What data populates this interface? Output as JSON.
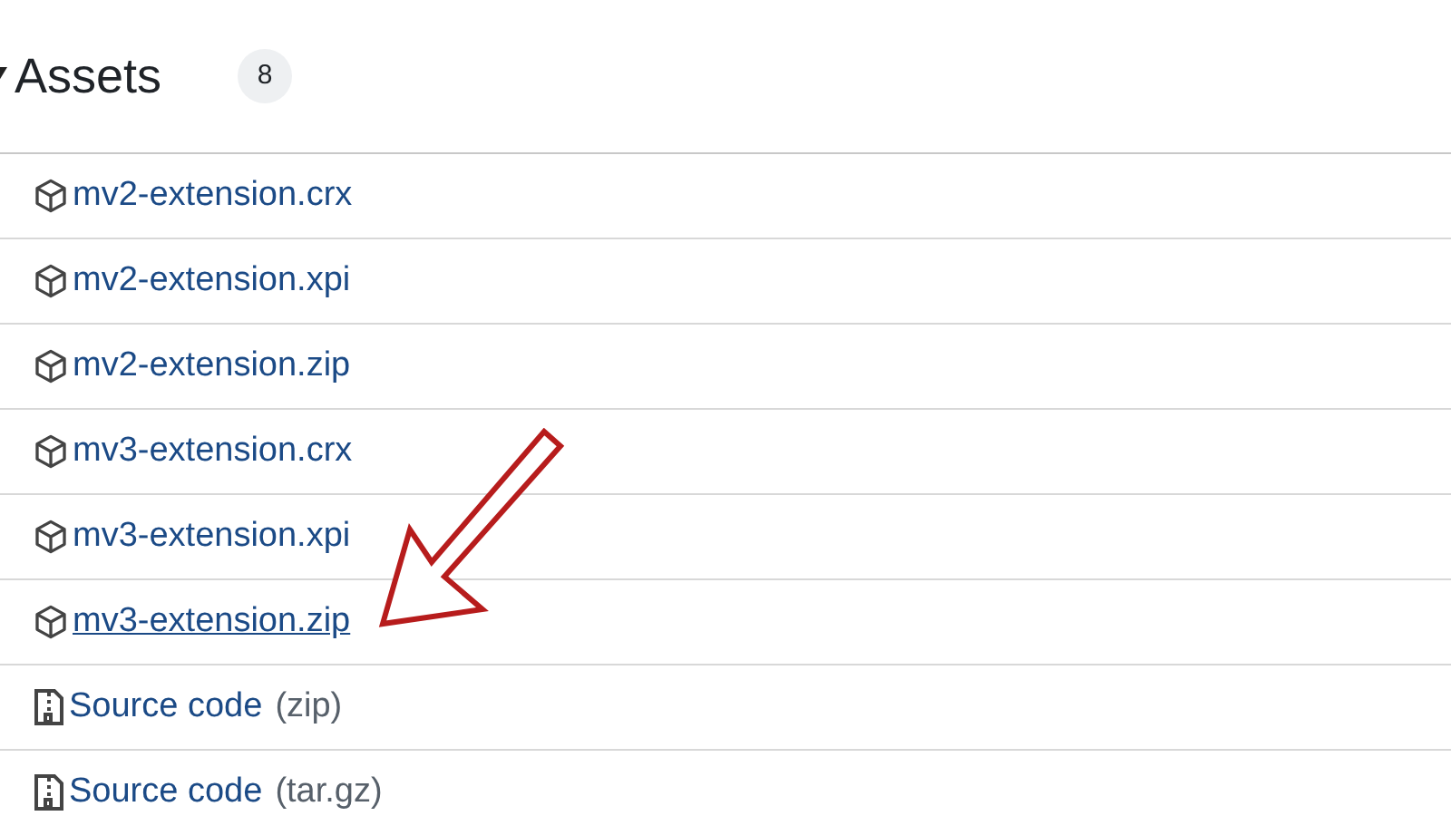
{
  "heading": {
    "title": "Assets",
    "count": "8",
    "expanded": true
  },
  "assets": [
    {
      "kind": "package",
      "name": "mv2-extension.crx",
      "hovered": false
    },
    {
      "kind": "package",
      "name": "mv2-extension.xpi",
      "hovered": false
    },
    {
      "kind": "package",
      "name": "mv2-extension.zip",
      "hovered": false
    },
    {
      "kind": "package",
      "name": "mv3-extension.crx",
      "hovered": false
    },
    {
      "kind": "package",
      "name": "mv3-extension.xpi",
      "hovered": false
    },
    {
      "kind": "package",
      "name": "mv3-extension.zip",
      "hovered": true
    },
    {
      "kind": "source",
      "name": "Source code",
      "format": "(zip)",
      "hovered": false
    },
    {
      "kind": "source",
      "name": "Source code",
      "format": "(tar.gz)",
      "hovered": false
    }
  ]
}
